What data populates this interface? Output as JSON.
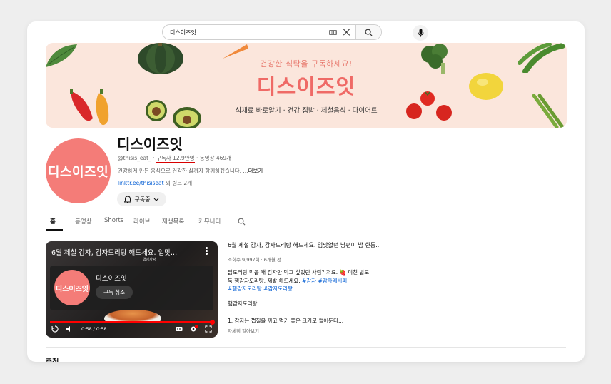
{
  "search": {
    "query": "디스이즈잇",
    "placeholder": ""
  },
  "banner": {
    "subtitle": "건강한 식탁을 구독하세요!",
    "title": "디스이즈잇",
    "tags": "식재료 바로알기 · 건강 집밥 · 제철음식 · 다이어트",
    "bg_color": "#fbe6dc"
  },
  "channel": {
    "avatar_text": "디스이즈잇",
    "name": "디스이즈잇",
    "handle": "@thisis_eat_ · ",
    "subscribers": "구독자 12.9만명",
    "videos": " · 동영상 469개",
    "description": "건강하게 만든 음식으로 건강한 삶까지 함께하겠습니다. ...",
    "more": "더보기",
    "link": "linktr.ee/thisiseat",
    "link_suffix": " 외 링크 2개",
    "subscribe_label": "구독중",
    "accent_color": "#f47c78"
  },
  "tabs": [
    "홈",
    "동영상",
    "Shorts",
    "라이브",
    "재생목록",
    "커뮤니티"
  ],
  "video": {
    "title": "6월 제철 감자, 감자도리탕 해드세요. 입맛...",
    "subtitle_label": "햄감자탕",
    "end_channel": "디스이즈잇",
    "end_avatar": "디스이즈잇",
    "unsubscribe": "구독 취소",
    "time": "0:58 / 0:58",
    "progress": 1.0
  },
  "details": {
    "title": "6월 제철 감자, 감자도리탕 해드세요. 입맛없던 남편이 밥 한통...",
    "stats": "조회수 9,997회 · 6개월 전",
    "desc_line1": "닭도리탕 먹을 때 감자만 먹고 싶었던 사람? 저요. ",
    "desc_emoji": "🍓",
    "desc_line1b": " 미친 밥도",
    "desc_line2": "둑 햄감자도리탕, 제발 해드세요. ",
    "desc_tag1": "#감자",
    "desc_tag2": "#감자레시피",
    "desc_tag3": "#햄감자도리탕",
    "desc_tag4": "#감자도리탕",
    "recipe_name": "햄감자도리탕",
    "step1": "1. 감자는 껍질을 까고 먹기 좋은 크기로 썰어둔다...",
    "more": "자세히 알아보기"
  },
  "section_heading": "추천"
}
